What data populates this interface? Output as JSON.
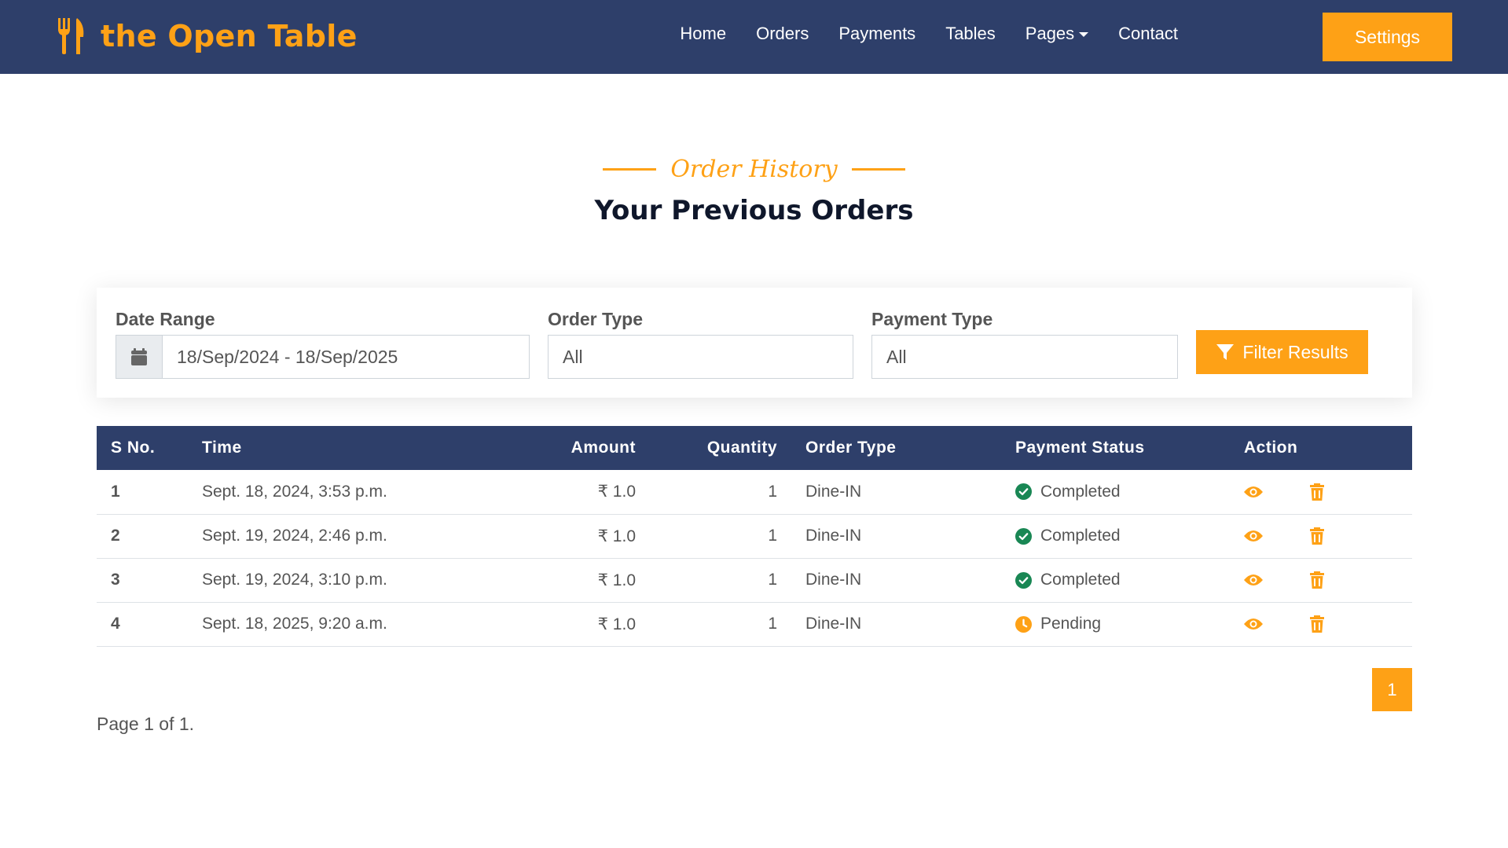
{
  "brand": {
    "name": "the Open Table"
  },
  "nav": {
    "items": [
      {
        "label": "Home"
      },
      {
        "label": "Orders"
      },
      {
        "label": "Payments"
      },
      {
        "label": "Tables"
      },
      {
        "label": "Pages"
      },
      {
        "label": "Contact"
      }
    ],
    "settings_label": "Settings"
  },
  "section": {
    "subtitle": "Order History",
    "title": "Your Previous Orders"
  },
  "filters": {
    "date_label": "Date Range",
    "date_value": "18/Sep/2024 - 18/Sep/2025",
    "order_type_label": "Order Type",
    "order_type_value": "All",
    "payment_type_label": "Payment Type",
    "payment_type_value": "All",
    "filter_button": "Filter Results"
  },
  "table": {
    "headers": [
      "S No.",
      "Time",
      "Amount",
      "Quantity",
      "Order Type",
      "Payment Status",
      "Action"
    ],
    "rows": [
      {
        "sno": "1",
        "time": "Sept. 18, 2024, 3:53 p.m.",
        "amount": "₹ 1.0",
        "quantity": "1",
        "order_type": "Dine-IN",
        "status": "Completed"
      },
      {
        "sno": "2",
        "time": "Sept. 19, 2024, 2:46 p.m.",
        "amount": "₹ 1.0",
        "quantity": "1",
        "order_type": "Dine-IN",
        "status": "Completed"
      },
      {
        "sno": "3",
        "time": "Sept. 19, 2024, 3:10 p.m.",
        "amount": "₹ 1.0",
        "quantity": "1",
        "order_type": "Dine-IN",
        "status": "Completed"
      },
      {
        "sno": "4",
        "time": "Sept. 18, 2025, 9:20 a.m.",
        "amount": "₹ 1.0",
        "quantity": "1",
        "order_type": "Dine-IN",
        "status": "Pending"
      }
    ]
  },
  "pagination": {
    "current_page": "1",
    "info": "Page 1 of 1."
  },
  "colors": {
    "primary": "#fea116",
    "navy": "#2e3f6a",
    "success": "#198754",
    "pending": "#fea116"
  },
  "icons": {
    "brand": "utensils-icon",
    "date": "calendar-icon",
    "filter": "filter-icon",
    "completed": "check-circle-icon",
    "pending": "clock-icon",
    "view": "eye-icon",
    "delete": "trash-icon"
  }
}
